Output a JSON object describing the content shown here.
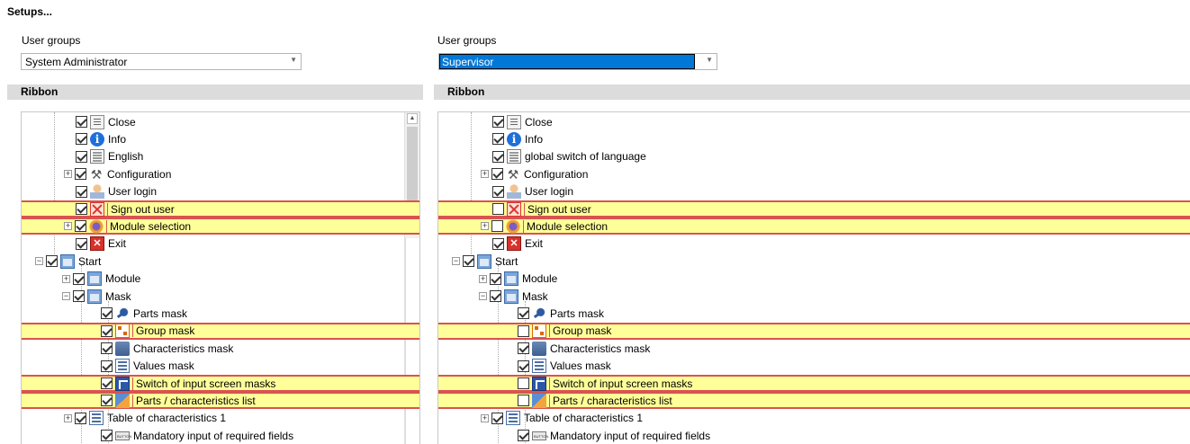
{
  "window": {
    "title": "Setups..."
  },
  "left": {
    "group_label": "User groups",
    "group_value": "System Administrator",
    "section": "Ribbon",
    "items": [
      {
        "label": "Close",
        "checked": true,
        "icon": "close-doc-icon",
        "expander": null,
        "level": 4,
        "highlight": false
      },
      {
        "label": "Info",
        "checked": true,
        "icon": "info-icon",
        "expander": null,
        "level": 4,
        "highlight": false
      },
      {
        "label": "English",
        "checked": true,
        "icon": "language-list-icon",
        "expander": null,
        "level": 4,
        "highlight": false
      },
      {
        "label": "Configuration",
        "checked": true,
        "icon": "tools-icon",
        "expander": "+",
        "level": 4,
        "highlight": false
      },
      {
        "label": "User login",
        "checked": true,
        "icon": "user-icon",
        "expander": null,
        "level": 4,
        "highlight": false
      },
      {
        "label": "Sign out user",
        "checked": true,
        "icon": "sign-out-icon",
        "expander": null,
        "level": 4,
        "highlight": true
      },
      {
        "label": "Module selection",
        "checked": true,
        "icon": "module-icon",
        "expander": "+",
        "level": 4,
        "highlight": true
      },
      {
        "label": "Exit",
        "checked": true,
        "icon": "exit-icon",
        "expander": null,
        "level": 4,
        "highlight": false
      },
      {
        "label": "Start",
        "checked": true,
        "icon": "window-icon",
        "expander": "-",
        "level": 2,
        "highlight": false
      },
      {
        "label": "Module",
        "checked": true,
        "icon": "window-icon",
        "expander": "+",
        "level": 3,
        "highlight": false
      },
      {
        "label": "Mask",
        "checked": true,
        "icon": "window-icon",
        "expander": "-",
        "level": 3,
        "highlight": false
      },
      {
        "label": "Parts mask",
        "checked": true,
        "icon": "parts-icon",
        "expander": null,
        "level": 5,
        "highlight": false
      },
      {
        "label": "Group mask",
        "checked": true,
        "icon": "group-icon",
        "expander": null,
        "level": 5,
        "highlight": true
      },
      {
        "label": "Characteristics mask",
        "checked": true,
        "icon": "characteristics-icon",
        "expander": null,
        "level": 5,
        "highlight": false
      },
      {
        "label": "Values mask",
        "checked": true,
        "icon": "values-icon",
        "expander": null,
        "level": 5,
        "highlight": false
      },
      {
        "label": "Switch of input screen masks",
        "checked": true,
        "icon": "switch-icon",
        "expander": null,
        "level": 5,
        "highlight": true
      },
      {
        "label": "Parts / characteristics list",
        "checked": true,
        "icon": "parts-list-icon",
        "expander": null,
        "level": 5,
        "highlight": true
      },
      {
        "label": "Table of characteristics 1",
        "checked": true,
        "icon": "values-icon",
        "expander": "+",
        "level": 4,
        "highlight": false
      },
      {
        "label": "Mandatory input of required fields",
        "checked": true,
        "icon": "button-icon",
        "expander": null,
        "level": 5,
        "highlight": false
      }
    ]
  },
  "right": {
    "group_label": "User groups",
    "group_value": "Supervisor",
    "section": "Ribbon",
    "items": [
      {
        "label": "Close",
        "checked": true,
        "icon": "close-doc-icon",
        "expander": null,
        "level": 4,
        "highlight": false
      },
      {
        "label": "Info",
        "checked": true,
        "icon": "info-icon",
        "expander": null,
        "level": 4,
        "highlight": false
      },
      {
        "label": "global switch of language",
        "checked": true,
        "icon": "language-list-icon",
        "expander": null,
        "level": 4,
        "highlight": false
      },
      {
        "label": "Configuration",
        "checked": true,
        "icon": "tools-icon",
        "expander": "+",
        "level": 4,
        "highlight": false
      },
      {
        "label": "User login",
        "checked": true,
        "icon": "user-icon",
        "expander": null,
        "level": 4,
        "highlight": false
      },
      {
        "label": "Sign out user",
        "checked": false,
        "icon": "sign-out-icon",
        "expander": null,
        "level": 4,
        "highlight": true
      },
      {
        "label": "Module selection",
        "checked": false,
        "icon": "module-icon",
        "expander": "+",
        "level": 4,
        "highlight": true
      },
      {
        "label": "Exit",
        "checked": true,
        "icon": "exit-icon",
        "expander": null,
        "level": 4,
        "highlight": false
      },
      {
        "label": "Start",
        "checked": true,
        "icon": "window-icon",
        "expander": "-",
        "level": 2,
        "highlight": false
      },
      {
        "label": "Module",
        "checked": true,
        "icon": "window-icon",
        "expander": "+",
        "level": 3,
        "highlight": false
      },
      {
        "label": "Mask",
        "checked": true,
        "icon": "window-icon",
        "expander": "-",
        "level": 3,
        "highlight": false
      },
      {
        "label": "Parts mask",
        "checked": true,
        "icon": "parts-icon",
        "expander": null,
        "level": 5,
        "highlight": false
      },
      {
        "label": "Group mask",
        "checked": false,
        "icon": "group-icon",
        "expander": null,
        "level": 5,
        "highlight": true
      },
      {
        "label": "Characteristics mask",
        "checked": true,
        "icon": "characteristics-icon",
        "expander": null,
        "level": 5,
        "highlight": false
      },
      {
        "label": "Values mask",
        "checked": true,
        "icon": "values-icon",
        "expander": null,
        "level": 5,
        "highlight": false
      },
      {
        "label": "Switch of input screen masks",
        "checked": false,
        "icon": "switch-icon",
        "expander": null,
        "level": 5,
        "highlight": true
      },
      {
        "label": "Parts / characteristics list",
        "checked": false,
        "icon": "parts-list-icon",
        "expander": null,
        "level": 5,
        "highlight": true
      },
      {
        "label": "Table of characteristics 1",
        "checked": true,
        "icon": "values-icon",
        "expander": "+",
        "level": 4,
        "highlight": false
      },
      {
        "label": "Mandatory input of required fields",
        "checked": true,
        "icon": "button-icon",
        "expander": null,
        "level": 5,
        "highlight": false
      }
    ]
  },
  "colors": {
    "highlight_bg": "#ffff99",
    "highlight_border": "#d9534f",
    "selection": "#0078d7"
  }
}
